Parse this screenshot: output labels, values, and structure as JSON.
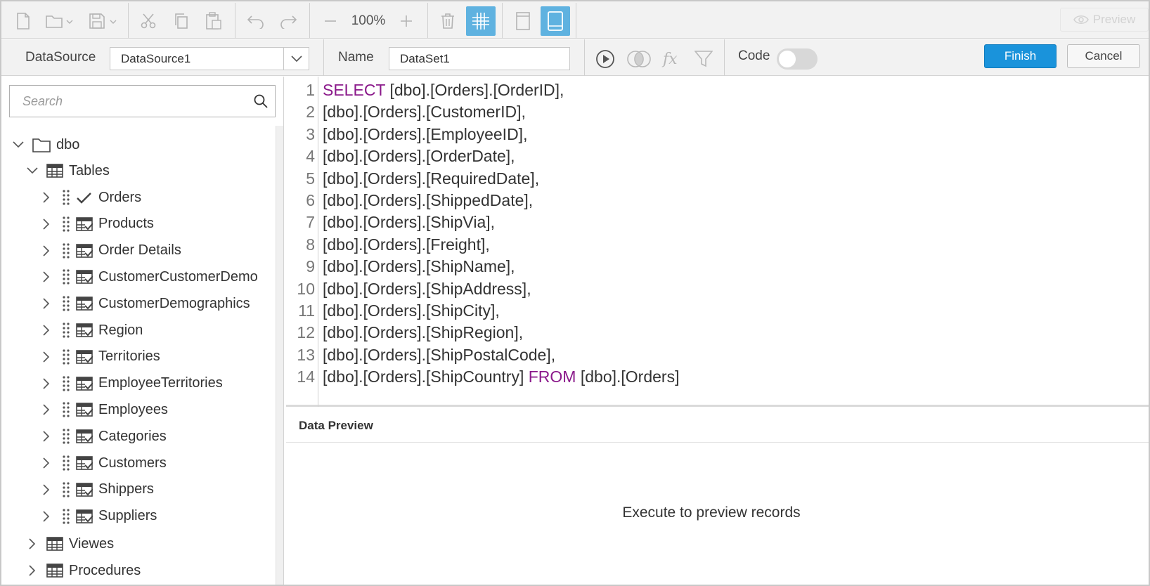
{
  "toolbar": {
    "zoom_label": "100%",
    "preview_label": "Preview",
    "icons": [
      "new-file-icon",
      "open-folder-icon",
      "save-icon",
      "cut-icon",
      "copy-icon",
      "paste-icon",
      "undo-icon",
      "redo-icon",
      "zoom-out-icon",
      "zoom-in-icon",
      "delete-icon",
      "grid-icon",
      "page-view-icon",
      "tablet-view-icon"
    ]
  },
  "datasource": {
    "label": "DataSource",
    "value": "DataSource1"
  },
  "name": {
    "label": "Name",
    "value": "DataSet1"
  },
  "code_toggle": {
    "label": "Code",
    "on": false
  },
  "actions": {
    "finish": "Finish",
    "cancel": "Cancel"
  },
  "search": {
    "placeholder": "Search"
  },
  "tree": {
    "root": "dbo",
    "tables_label": "Tables",
    "tables": [
      "Orders",
      "Products",
      "Order Details",
      "CustomerCustomerDemo",
      "CustomerDemographics",
      "Region",
      "Territories",
      "EmployeeTerritories",
      "Employees",
      "Categories",
      "Customers",
      "Shippers",
      "Suppliers"
    ],
    "checked_table": "Orders",
    "views_label": "Viewes",
    "procedures_label": "Procedures"
  },
  "editor": {
    "line_numbers": [
      "1",
      "2",
      "3",
      "4",
      "5",
      "6",
      "7",
      "8",
      "9",
      "10",
      "11",
      "12",
      "13",
      "14"
    ],
    "lines": [
      {
        "kw1": "SELECT",
        "text": " [dbo].[Orders].[OrderID],",
        "kw2": "",
        "tail": ""
      },
      {
        "kw1": "",
        "text": "[dbo].[Orders].[CustomerID],",
        "kw2": "",
        "tail": ""
      },
      {
        "kw1": "",
        "text": "[dbo].[Orders].[EmployeeID],",
        "kw2": "",
        "tail": ""
      },
      {
        "kw1": "",
        "text": "[dbo].[Orders].[OrderDate],",
        "kw2": "",
        "tail": ""
      },
      {
        "kw1": "",
        "text": "[dbo].[Orders].[RequiredDate],",
        "kw2": "",
        "tail": ""
      },
      {
        "kw1": "",
        "text": "[dbo].[Orders].[ShippedDate],",
        "kw2": "",
        "tail": ""
      },
      {
        "kw1": "",
        "text": "[dbo].[Orders].[ShipVia],",
        "kw2": "",
        "tail": ""
      },
      {
        "kw1": "",
        "text": "[dbo].[Orders].[Freight],",
        "kw2": "",
        "tail": ""
      },
      {
        "kw1": "",
        "text": "[dbo].[Orders].[ShipName],",
        "kw2": "",
        "tail": ""
      },
      {
        "kw1": "",
        "text": "[dbo].[Orders].[ShipAddress],",
        "kw2": "",
        "tail": ""
      },
      {
        "kw1": "",
        "text": "[dbo].[Orders].[ShipCity],",
        "kw2": "",
        "tail": ""
      },
      {
        "kw1": "",
        "text": "[dbo].[Orders].[ShipRegion],",
        "kw2": "",
        "tail": ""
      },
      {
        "kw1": "",
        "text": "[dbo].[Orders].[ShipPostalCode],",
        "kw2": "",
        "tail": ""
      },
      {
        "kw1": "",
        "text": "[dbo].[Orders].[ShipCountry] ",
        "kw2": "FROM",
        "tail": " [dbo].[Orders]"
      }
    ]
  },
  "data_preview": {
    "title": "Data Preview",
    "message": "Execute to preview records"
  },
  "colors": {
    "accent": "#1a93db",
    "keyword": "#8b1a8b",
    "active_toggle": "#5fb2e0"
  }
}
